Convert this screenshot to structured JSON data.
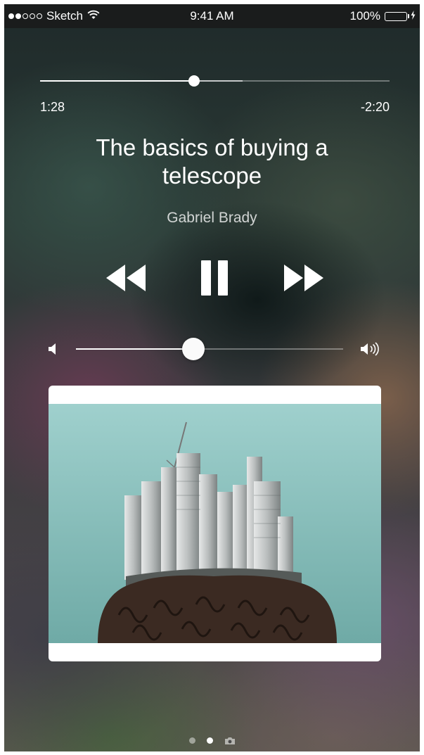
{
  "status_bar": {
    "carrier": "Sketch",
    "time": "9:41 AM",
    "battery_percent": "100%",
    "signal_bars_filled": 2,
    "signal_bars_total": 5,
    "battery_color": "#4cd964"
  },
  "player": {
    "elapsed": "1:28",
    "remaining": "-2:20",
    "progress_fraction": 0.44,
    "buffered_fraction": 0.58,
    "title": "The basics of buying a telescope",
    "artist": "Gabriel Brady",
    "volume_fraction": 0.44,
    "controls": {
      "rewind_icon": "rewind-icon",
      "pause_icon": "pause-icon",
      "fastforward_icon": "fast-forward-icon"
    }
  },
  "artwork": {
    "description_icon": "album-artwork",
    "background_color": "#8fc6c3"
  },
  "page_indicator": {
    "pages": 3,
    "active_index": 1,
    "last_icon": "camera-icon"
  }
}
